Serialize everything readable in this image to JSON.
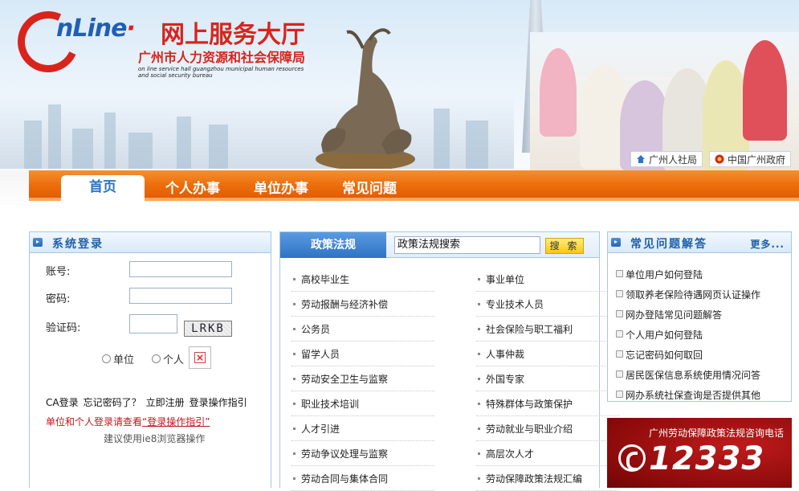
{
  "header": {
    "logo_online": "nLine",
    "logo_hall": "网上服务大厅",
    "logo_bureau": "广州市人力资源和社会保障局",
    "logo_english": "on line service hall guangzhou municipal human resources and social security bureau",
    "quicklinks": [
      {
        "label": "广州人社局",
        "icon": "home-icon"
      },
      {
        "label": "中国广州政府",
        "icon": "emblem-icon"
      }
    ]
  },
  "nav": {
    "tabs": [
      {
        "label": "首页",
        "active": true
      },
      {
        "label": "个人办事",
        "active": false
      },
      {
        "label": "单位办事",
        "active": false
      },
      {
        "label": "常见问题",
        "active": false
      }
    ]
  },
  "login": {
    "title": "系统登录",
    "account_label": "账号:",
    "password_label": "密码:",
    "captcha_label": "验证码:",
    "captcha_text": "LRKB",
    "radio_unit": "单位",
    "radio_personal": "个人",
    "links": [
      "CA登录",
      "忘记密码了？",
      "立即注册",
      "登录操作指引"
    ],
    "tip_prefix": "单位和个人登录请查看",
    "tip_link": "“登录操作指引”",
    "browser_tip": "建议使用ie8浏览器操作"
  },
  "policy": {
    "tab_label": "政策法规",
    "search_value": "政策法规搜索",
    "search_button": "搜 索",
    "left_items": [
      "高校毕业生",
      "劳动报酬与经济补偿",
      "公务员",
      "留学人员",
      "劳动安全卫生与监察",
      "职业技术培训",
      "人才引进",
      "劳动争议处理与监察",
      "劳动合同与集体合同"
    ],
    "right_items": [
      "事业单位",
      "专业技术人员",
      "社会保险与职工福利",
      "人事仲裁",
      "外国专家",
      "特殊群体与政策保护",
      "劳动就业与职业介绍",
      "高层次人才",
      "劳动保障政策法规汇编"
    ]
  },
  "faq": {
    "title": "常见问题解答",
    "more": "更多...",
    "items": [
      "单位用户如何登陆",
      "领取养老保险待遇网页认证操作",
      "网办登陆常见问题解答",
      "个人用户如何登陆",
      "忘记密码如何取回",
      "居民医保信息系统使用情况问答",
      "网办系统社保查询是否提供其他"
    ]
  },
  "hotline": {
    "title": "广州劳动保障政策法规咨询电话",
    "number": "12333"
  },
  "colors": {
    "nav_orange": "#ec6d0c",
    "brand_red": "#d9241c",
    "brand_blue": "#1f5fb5",
    "panel_border": "#a9c7e3"
  }
}
